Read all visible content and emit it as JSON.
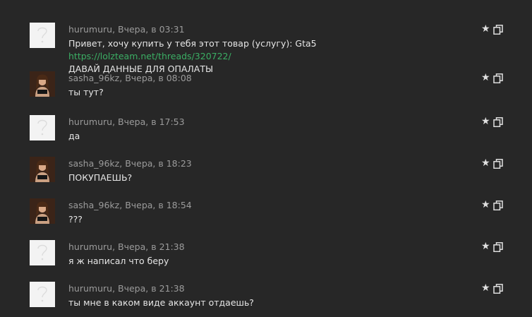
{
  "messages": [
    {
      "author": "hurumuru",
      "time": "Вчера, в 03:31",
      "avatar": "default",
      "lines": [
        {
          "text": "Привет, хочу купить у тебя этот товар (услугу): Gta5 ",
          "link": "https://lolzteam.net/threads/320722/"
        },
        {
          "text": "ДАВАЙ ДАННЫЕ ДЛЯ ОПАЛАТЫ",
          "link": ""
        }
      ]
    },
    {
      "author": "sasha_96kz",
      "time": "Вчера, в 08:08",
      "avatar": "photo",
      "lines": [
        {
          "text": "ты тут?",
          "link": ""
        }
      ]
    },
    {
      "author": "hurumuru",
      "time": "Вчера, в 17:53",
      "avatar": "default",
      "lines": [
        {
          "text": "да",
          "link": ""
        }
      ]
    },
    {
      "author": "sasha_96kz",
      "time": "Вчера, в 18:23",
      "avatar": "photo",
      "lines": [
        {
          "text": "ПОКУПАЕШЬ?",
          "link": ""
        }
      ]
    },
    {
      "author": "sasha_96kz",
      "time": "Вчера, в 18:54",
      "avatar": "photo",
      "lines": [
        {
          "text": "???",
          "link": ""
        }
      ]
    },
    {
      "author": "hurumuru",
      "time": "Вчера, в 21:38",
      "avatar": "default",
      "lines": [
        {
          "text": "я ж написал что беру",
          "link": ""
        }
      ]
    },
    {
      "author": "hurumuru",
      "time": "Вчера, в 21:38",
      "avatar": "default",
      "lines": [
        {
          "text": "ты мне в каком виде аккаунт отдаешь?",
          "link": ""
        }
      ]
    }
  ],
  "icons": {
    "star": "star-icon",
    "copy": "copy-icon"
  },
  "colors": {
    "background": "#272727",
    "link": "#3bae64",
    "meta": "#9b9b9b",
    "text": "#e6e6e6"
  }
}
